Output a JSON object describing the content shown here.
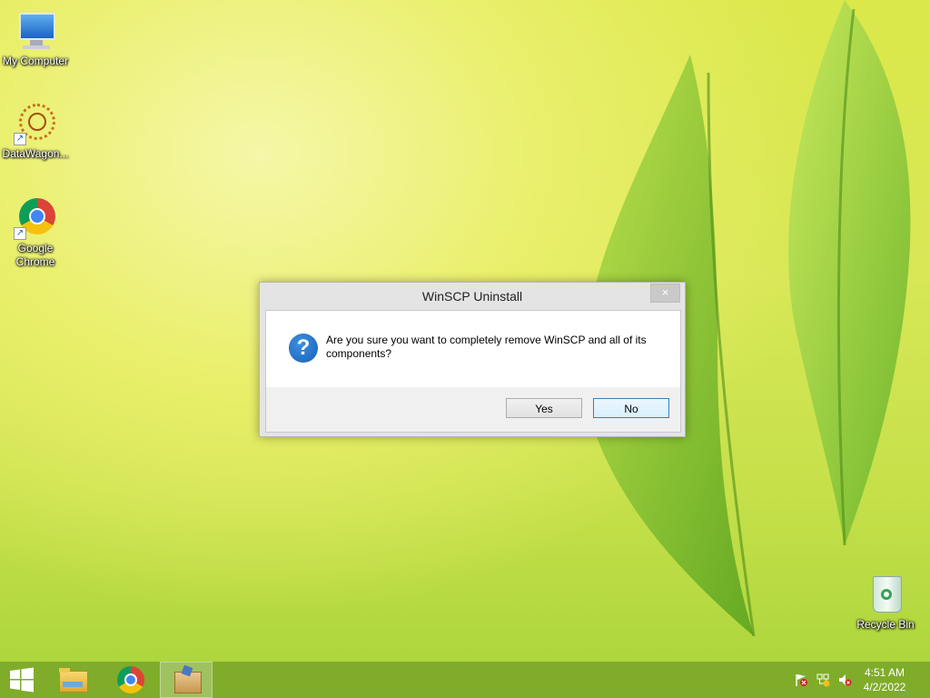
{
  "desktop": {
    "icons": [
      {
        "label": "My Computer",
        "icon": "computer-icon"
      },
      {
        "label": "DataWagon...",
        "icon": "datawagon-icon"
      },
      {
        "label": "Google Chrome",
        "icon": "chrome-icon"
      },
      {
        "label": "Recycle Bin",
        "icon": "recycle-bin-icon"
      }
    ]
  },
  "dialog": {
    "title": "WinSCP Uninstall",
    "close_symbol": "×",
    "message": "Are you sure you want to completely remove WinSCP and all of its components?",
    "icon": "question-icon",
    "yes_label": "Yes",
    "no_label": "No"
  },
  "taskbar": {
    "items": [
      "start-button",
      "file-explorer-icon",
      "chrome-icon",
      "installer-icon"
    ],
    "clock": {
      "time": "4:51 AM",
      "date": "4/2/2022"
    },
    "tray": [
      "action-center-flag-icon",
      "network-icon",
      "volume-muted-icon"
    ]
  },
  "colors": {
    "accent": "#1762b8",
    "taskbar": "#78a528"
  }
}
